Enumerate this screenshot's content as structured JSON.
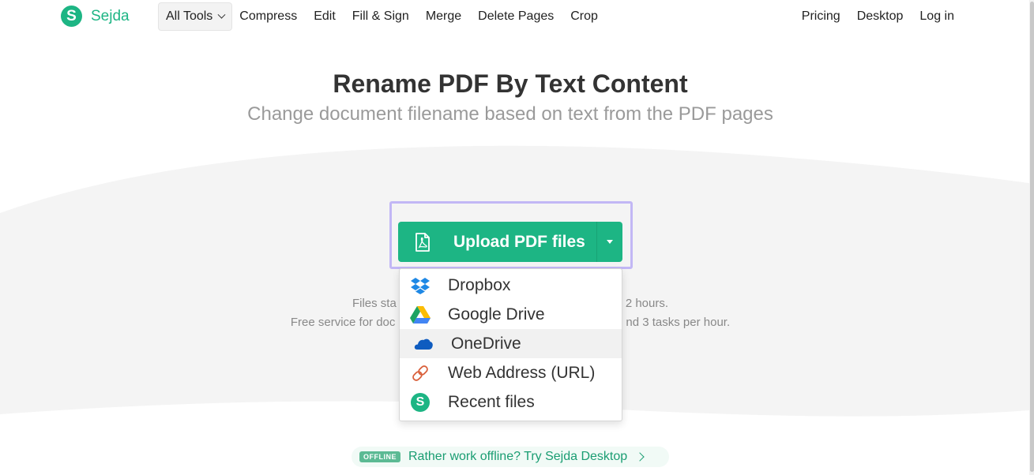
{
  "brand": {
    "logo_letter": "S",
    "name": "Sejda",
    "accent": "#1db584"
  },
  "nav": {
    "all_tools": "All Tools",
    "items": [
      "Compress",
      "Edit",
      "Fill & Sign",
      "Merge",
      "Delete Pages",
      "Crop"
    ],
    "right": [
      "Pricing",
      "Desktop",
      "Log in"
    ]
  },
  "hero": {
    "title": "Rename PDF By Text Content",
    "subtitle": "Change document filename based on text from the PDF pages"
  },
  "upload": {
    "label": "Upload PDF files",
    "icon": "pdf-file-icon",
    "focus_color": "#c2b7f5"
  },
  "info": {
    "line1_left": "Files sta",
    "line1_right": "2 hours.",
    "line2_left": "Free service for doc",
    "line2_right": "nd 3 tasks per hour."
  },
  "dropdown": {
    "items": [
      {
        "label": "Dropbox",
        "icon": "dropbox-icon"
      },
      {
        "label": "Google Drive",
        "icon": "google-drive-icon"
      },
      {
        "label": "OneDrive",
        "icon": "onedrive-icon",
        "highlighted": true
      },
      {
        "label": "Web Address (URL)",
        "icon": "link-icon"
      },
      {
        "label": "Recent files",
        "icon": "sejda-icon"
      }
    ]
  },
  "offline": {
    "badge": "OFFLINE",
    "text": "Rather work offline? Try Sejda Desktop"
  }
}
